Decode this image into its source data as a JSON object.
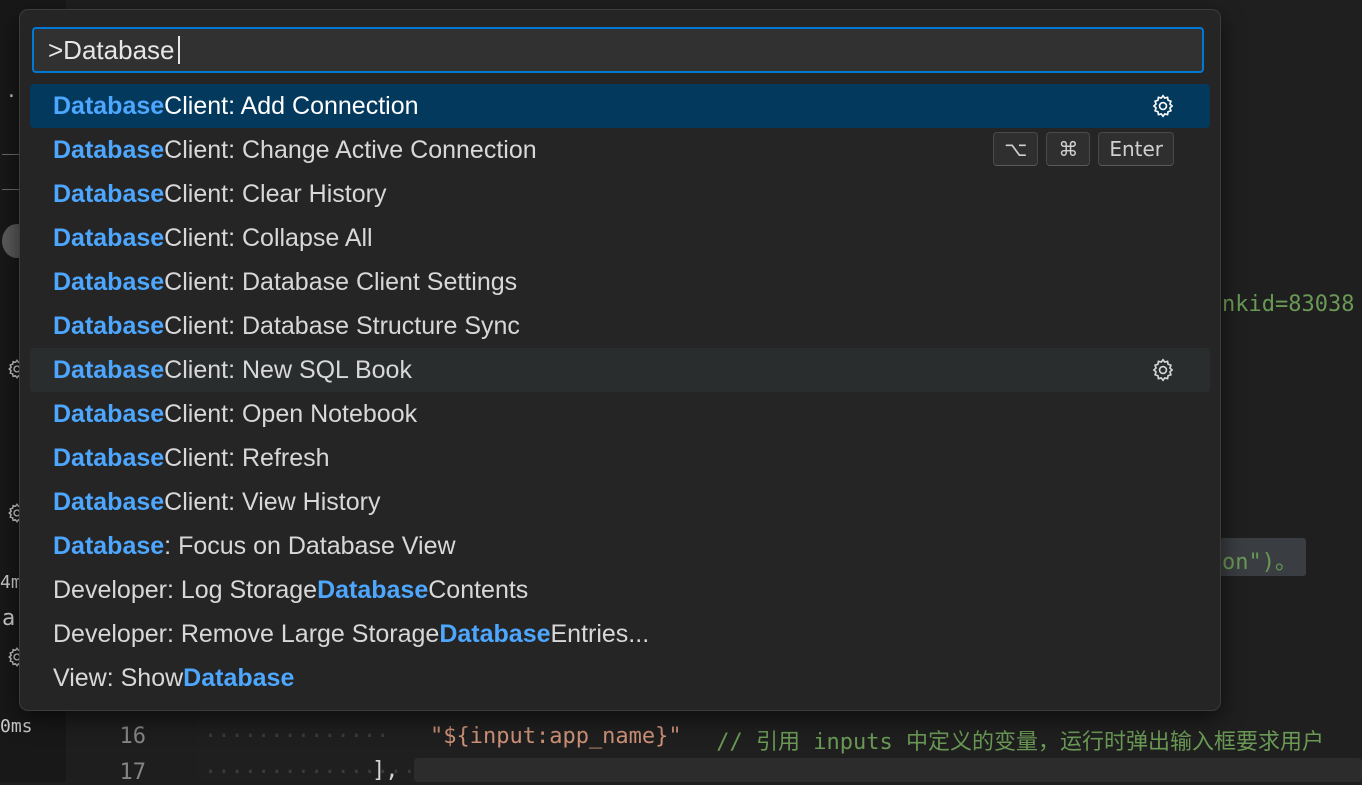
{
  "palette": {
    "query": ">Database",
    "items": [
      {
        "hl": "Database",
        "text": " Client: Add Connection"
      },
      {
        "hl": "Database",
        "text": " Client: Change Active Connection"
      },
      {
        "hl": "Database",
        "text": " Client: Clear History"
      },
      {
        "hl": "Database",
        "text": " Client: Collapse All"
      },
      {
        "hl": "Database",
        "text": " Client: Database Client Settings"
      },
      {
        "hl": "Database",
        "text": " Client: Database Structure Sync"
      },
      {
        "hl": "Database",
        "text": " Client: New SQL Book"
      },
      {
        "hl": "Database",
        "text": " Client: Open Notebook"
      },
      {
        "hl": "Database",
        "text": " Client: Refresh"
      },
      {
        "hl": "Database",
        "text": " Client: View History"
      },
      {
        "hl": "Database",
        "text": ": Focus on Database View"
      },
      {
        "pre": "Developer: Log Storage ",
        "hl": "Database",
        "text": " Contents"
      },
      {
        "pre": "Developer: Remove Large Storage ",
        "hl": "Database",
        "text": " Entries..."
      },
      {
        "pre": "View: Show ",
        "hl": "Database",
        "text": ""
      }
    ],
    "keybinding": [
      "⌥",
      "⌘",
      "Enter"
    ]
  },
  "editor": {
    "line_numbers": [
      "16",
      "17"
    ],
    "line16_dots": "··············",
    "line16_string": "\"${input:app_name}\"",
    "line16_comment": " // 引用 inputs 中定义的变量，运行时弹出输入框要求用户",
    "frag_url": "nkid=83038",
    "frag_on": "on\")。",
    "line17_dots": "···················",
    "line17_bracket": "],"
  },
  "sidebar_fragments": {
    "dot": "·",
    "ms1": "4m",
    "a": "a",
    "ms2": "0ms"
  },
  "colors": {
    "accent": "#0078d4",
    "highlight": "#4da7ff",
    "selected_bg": "#04395e"
  }
}
